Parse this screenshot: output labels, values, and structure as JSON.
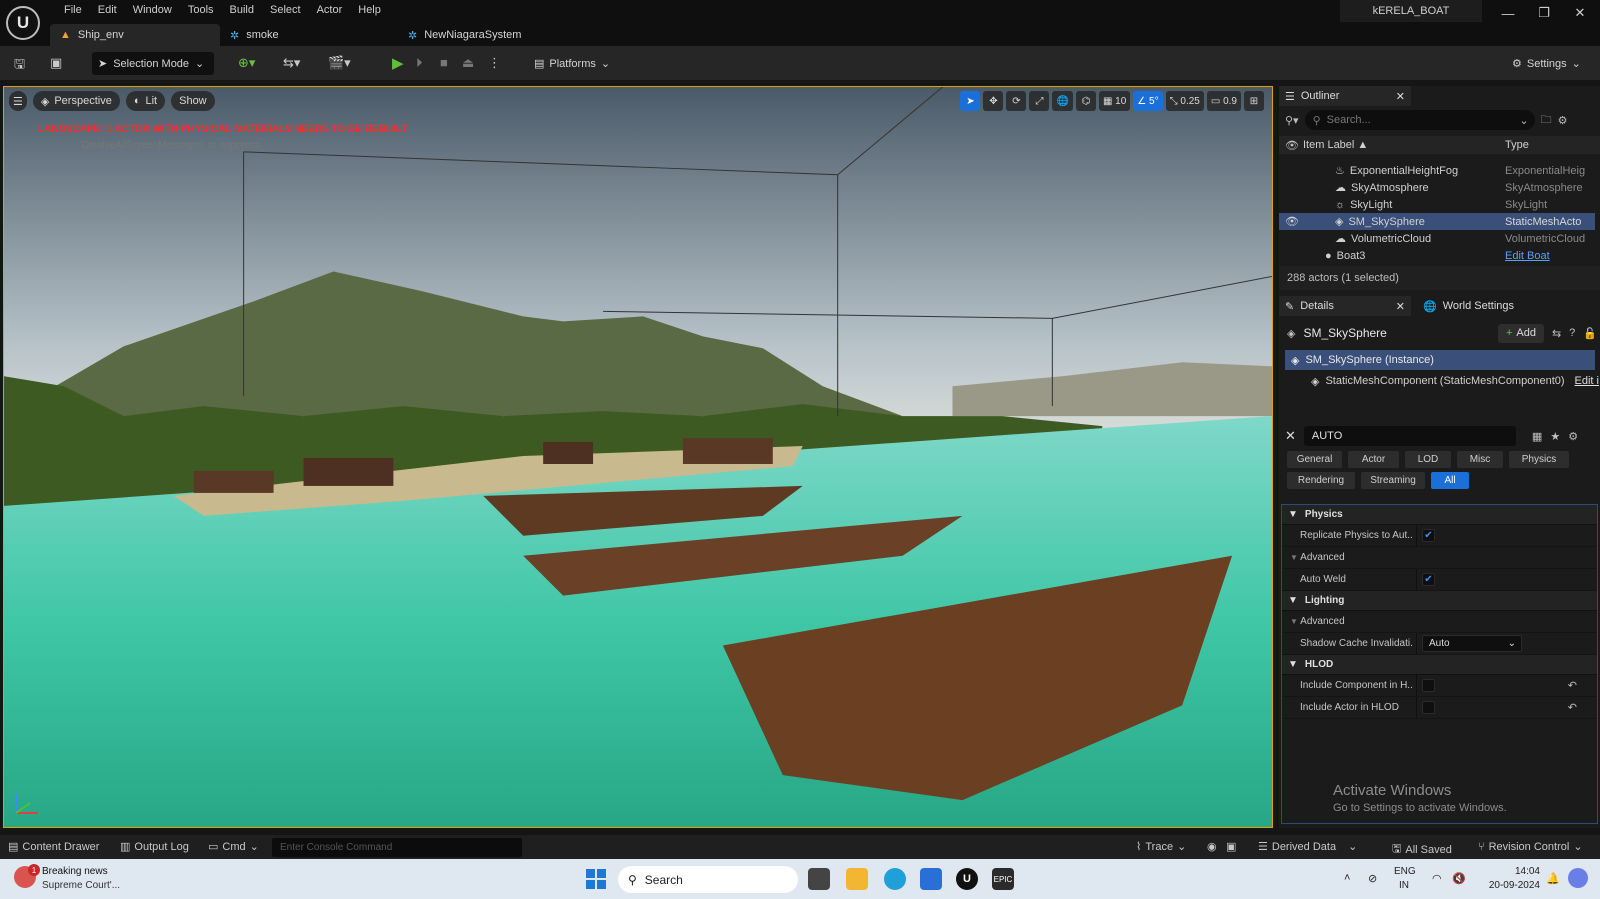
{
  "menu": [
    "File",
    "Edit",
    "Window",
    "Tools",
    "Build",
    "Select",
    "Actor",
    "Help"
  ],
  "tabs": [
    {
      "label": "Ship_env",
      "icon": "level-icon"
    },
    {
      "label": "smoke",
      "icon": "niagara-icon"
    },
    {
      "label": "NewNiagaraSystem",
      "icon": "niagara-icon"
    }
  ],
  "project_name": "kERELA_BOAT",
  "window_controls": [
    "—",
    "❐",
    "✕"
  ],
  "toolbar": {
    "selection_mode": "Selection Mode",
    "platforms": "Platforms",
    "settings": "Settings"
  },
  "viewport": {
    "perspective": "Perspective",
    "lit": "Lit",
    "show": "Show",
    "warning": "LANDSCAPE: 1 ACTOR WITH PHYSICAL MATERIALS NEEDS TO BE REBUILT",
    "warning_sub": "'DisableAllScreenMessages' to suppress",
    "grid_snap": "10",
    "rot_snap": "5°",
    "scale_snap": "0.25",
    "camera_speed": "0.9"
  },
  "outliner": {
    "title": "Outliner",
    "search_placeholder": "Search...",
    "col_label": "Item Label ▲",
    "col_type": "Type",
    "rows": [
      {
        "label": "ExponentialHeightFog",
        "type": "ExponentialHeig"
      },
      {
        "label": "SkyAtmosphere",
        "type": "SkyAtmosphere"
      },
      {
        "label": "SkyLight",
        "type": "SkyLight"
      },
      {
        "label": "SM_SkySphere",
        "type": "StaticMeshActo"
      },
      {
        "label": "VolumetricCloud",
        "type": "VolumetricCloud"
      },
      {
        "label": "Boat3",
        "type": "Edit Boat"
      }
    ],
    "status": "288 actors (1 selected)"
  },
  "details": {
    "tab_details": "Details",
    "tab_world": "World Settings",
    "actor_name": "SM_SkySphere",
    "add_label": "Add",
    "instance": "SM_SkySphere (Instance)",
    "component": "StaticMeshComponent (StaticMeshComponent0)",
    "component_edit": "Edit i",
    "search_value": "AUTO",
    "filter_tabs": [
      "General",
      "Actor",
      "LOD",
      "Misc",
      "Physics",
      "Rendering",
      "Streaming",
      "All"
    ],
    "sections": {
      "physics": "Physics",
      "replicate": "Replicate Physics to Aut...",
      "advanced1": "Advanced",
      "auto_weld": "Auto Weld",
      "lighting": "Lighting",
      "advanced2": "Advanced",
      "shadow_cache": "Shadow Cache Invalidati...",
      "shadow_value": "Auto",
      "hlod": "HLOD",
      "include_component": "Include Component in H...",
      "include_actor": "Include Actor in HLOD"
    },
    "watermark_title": "Activate Windows",
    "watermark_sub": "Go to Settings to activate Windows."
  },
  "bottom": {
    "content_drawer": "Content Drawer",
    "output_log": "Output Log",
    "cmd": "Cmd",
    "console_placeholder": "Enter Console Command",
    "trace": "Trace",
    "derived_data": "Derived Data",
    "all_saved": "All Saved",
    "revision_control": "Revision Control"
  },
  "taskbar": {
    "news_title": "Breaking news",
    "news_sub": "Supreme Court'...",
    "news_badge": "1",
    "search": "Search",
    "lang1": "ENG",
    "lang2": "IN",
    "time": "14:04",
    "date": "20-09-2024"
  },
  "colors": {
    "accent": "#1a6fd8",
    "warning": "#ff2a2a",
    "viewport_border": "#e0a000"
  }
}
